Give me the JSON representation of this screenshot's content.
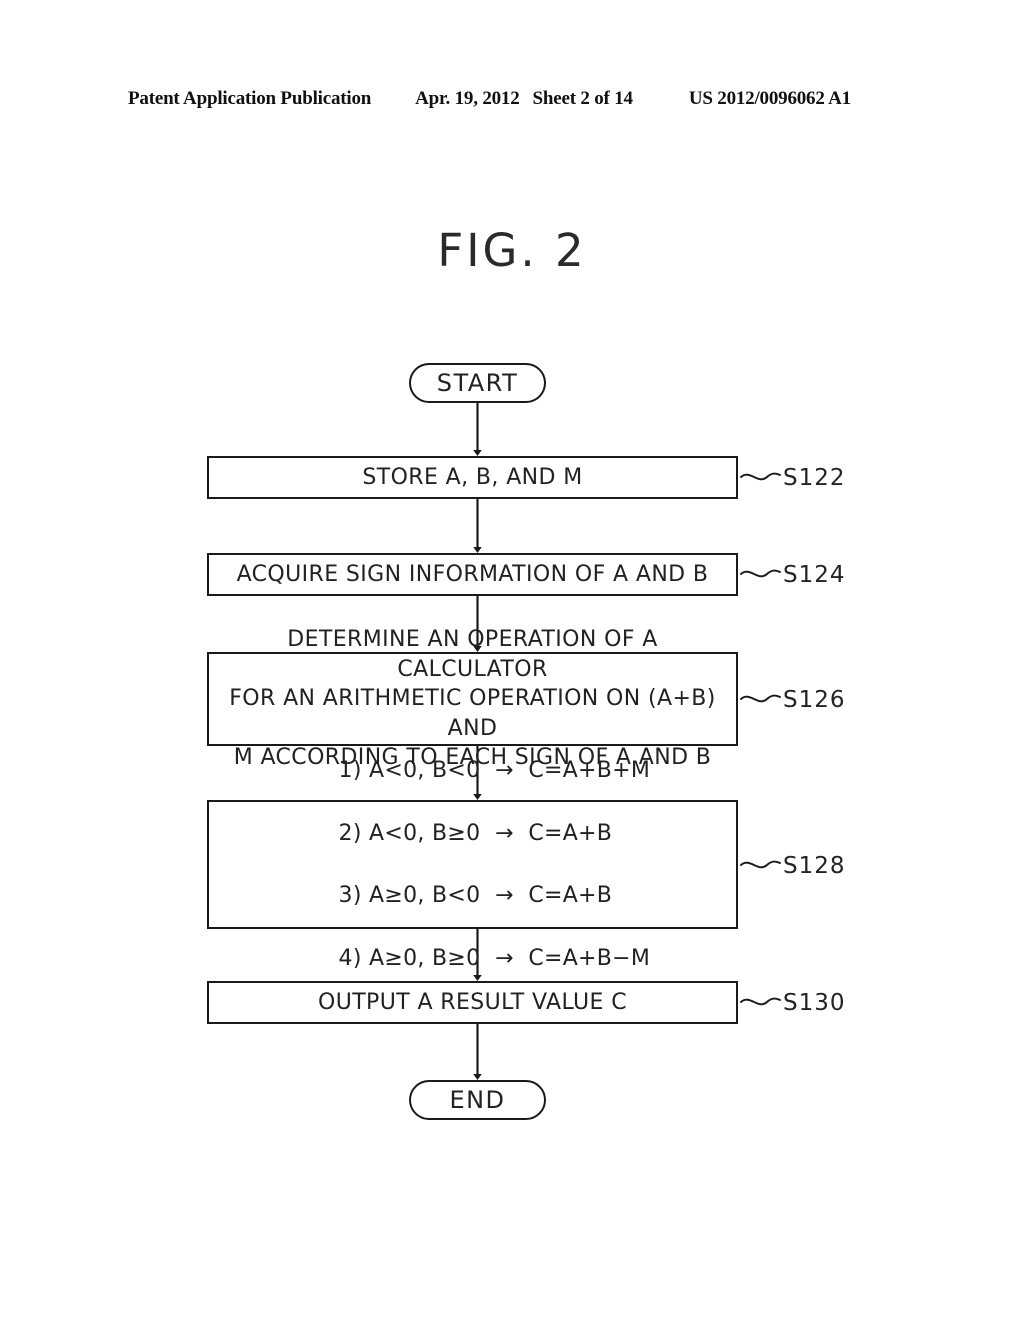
{
  "header": {
    "publication": "Patent Application Publication",
    "date": "Apr. 19, 2012",
    "sheet": "Sheet 2 of 14",
    "patent_number": "US 2012/0096062 A1"
  },
  "figure": {
    "title": "FIG. 2"
  },
  "flowchart": {
    "nodes": {
      "start": {
        "label": "START",
        "shape": "terminator"
      },
      "s122": {
        "label": "STORE A, B, AND M",
        "shape": "process",
        "step": "S122"
      },
      "s124": {
        "label": "ACQUIRE SIGN INFORMATION OF A AND B",
        "shape": "process",
        "step": "S124"
      },
      "s126": {
        "line1": "DETERMINE AN OPERATION OF A CALCULATOR",
        "line2": "FOR AN ARITHMETIC OPERATION ON (A+B) AND",
        "line3": "M ACCORDING TO EACH SIGN OF A AND B",
        "shape": "process",
        "step": "S126"
      },
      "s128": {
        "line1": "1) A<0, B<0  →  C=A+B+M",
        "line2": "2) A<0, B≥0  →  C=A+B",
        "line3": "3) A≥0, B<0  →  C=A+B",
        "line4": "4) A≥0, B≥0  →  C=A+B−M",
        "shape": "process",
        "step": "S128"
      },
      "s130": {
        "label": "OUTPUT A RESULT VALUE C",
        "shape": "process",
        "step": "S130"
      },
      "end": {
        "label": "END",
        "shape": "terminator"
      }
    },
    "connectors": [
      {
        "from": "start",
        "to": "s122",
        "arrow": true
      },
      {
        "from": "s122",
        "to": "s124",
        "arrow": true
      },
      {
        "from": "s124",
        "to": "s126",
        "arrow": true
      },
      {
        "from": "s126",
        "to": "s128",
        "arrow": true
      },
      {
        "from": "s128",
        "to": "s130",
        "arrow": true
      },
      {
        "from": "s130",
        "to": "end",
        "arrow": true
      }
    ],
    "colors": {
      "stroke": "#1a1a1a",
      "text": "#222222",
      "background": "#ffffff"
    }
  }
}
